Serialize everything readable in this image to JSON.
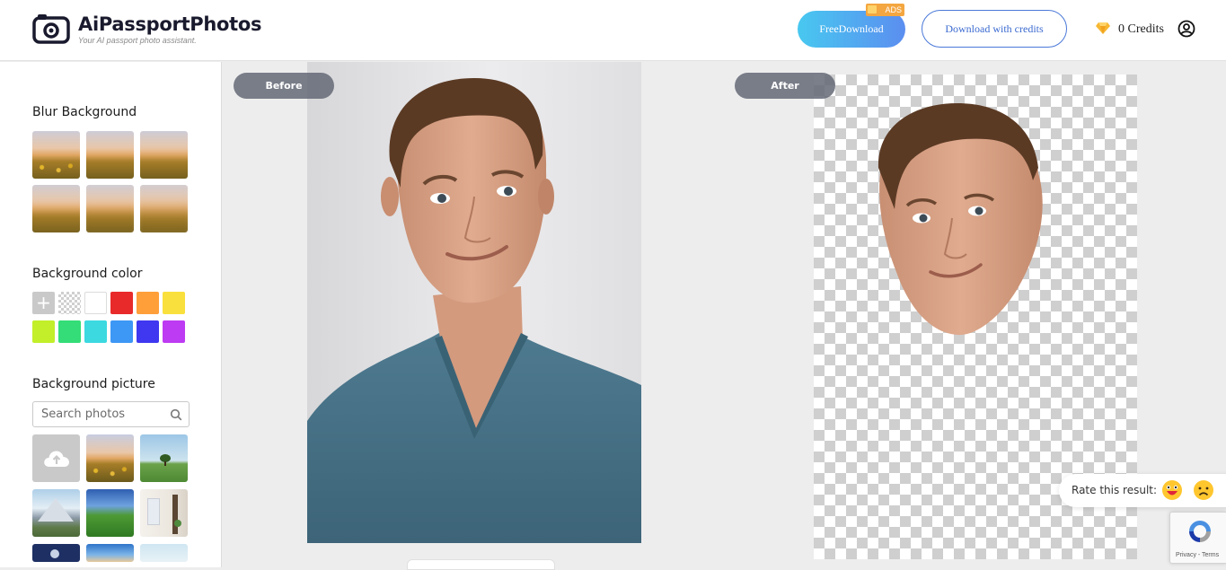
{
  "header": {
    "brand": "AiPassportPhotos",
    "tagline": "Your AI passport photo assistant.",
    "free_download_label": "FreeDownload",
    "ads_badge": "ADS",
    "download_credits_label": "Download with credits",
    "credits_text": "0 Credits"
  },
  "sidebar": {
    "blur_title": "Blur Background",
    "color_title": "Background color",
    "picture_title": "Background picture",
    "search_placeholder": "Search photos",
    "swatch_colors": [
      "#e82a2a",
      "#ff9f3a",
      "#fae03c",
      "#c2ef2a",
      "#34dd77",
      "#3cd9e0",
      "#3d97f5",
      "#3f38f0",
      "#bd3bf2"
    ]
  },
  "main": {
    "before_label": "Before",
    "after_label": "After"
  },
  "rating": {
    "prompt": "Rate this result:"
  },
  "recaptcha": {
    "links": "Privacy - Terms"
  }
}
